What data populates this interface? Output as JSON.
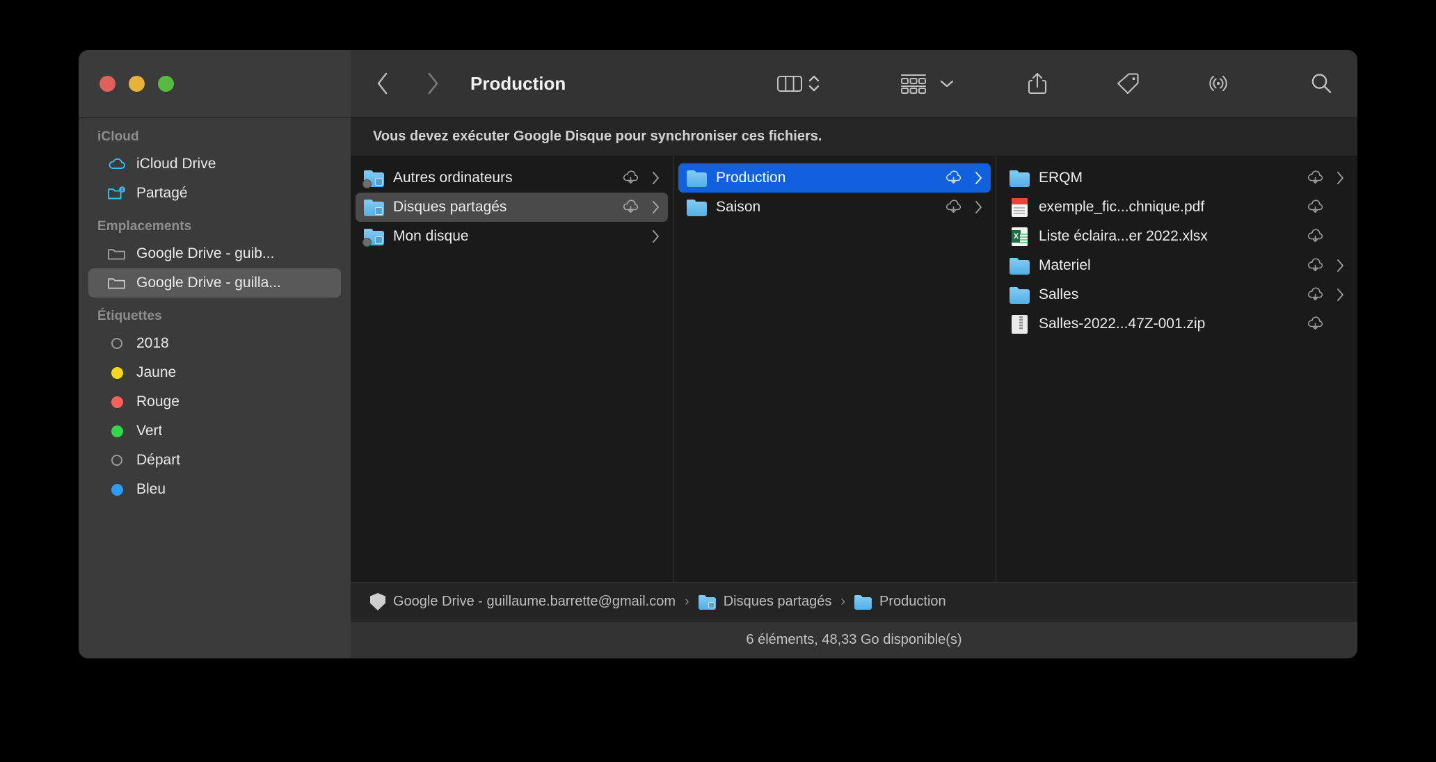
{
  "window": {
    "title": "Production",
    "traffic_lights": [
      {
        "name": "close",
        "color": "#e0615a"
      },
      {
        "name": "minimize",
        "color": "#e8b13c"
      },
      {
        "name": "zoom",
        "color": "#57bb43"
      }
    ]
  },
  "toolbar": {
    "back_label": "‹",
    "forward_label": "›",
    "title": "Production",
    "icons": [
      {
        "name": "column-view-icon",
        "label": "Présentation par colonnes"
      },
      {
        "name": "sort-stepper-icon",
        "label": "Trier"
      },
      {
        "name": "group-by-icon",
        "label": "Grouper"
      },
      {
        "name": "chevron-down-icon",
        "label": "Menu"
      },
      {
        "name": "share-icon",
        "label": "Partager"
      },
      {
        "name": "tag-icon",
        "label": "Étiquettes"
      },
      {
        "name": "airdrop-icon",
        "label": "AirDrop"
      },
      {
        "name": "search-icon",
        "label": "Rechercher"
      }
    ]
  },
  "banner": {
    "text": "Vous devez exécuter Google Disque pour synchroniser ces fichiers."
  },
  "sidebar": {
    "sections": [
      {
        "title": "iCloud",
        "items": [
          {
            "label": "iCloud Drive",
            "icon": "cloud-icon",
            "selected": false
          },
          {
            "label": "Partagé",
            "icon": "shared-folder-icon",
            "selected": false
          }
        ]
      },
      {
        "title": "Emplacements",
        "items": [
          {
            "label": "Google Drive - guib...",
            "icon": "folder-outline-icon",
            "selected": false
          },
          {
            "label": "Google Drive - guilla...",
            "icon": "folder-outline-icon",
            "selected": true
          }
        ]
      },
      {
        "title": "Étiquettes",
        "items": [
          {
            "label": "2018",
            "icon": "tag-dot-hollow",
            "color": "transparent",
            "selected": false
          },
          {
            "label": "Jaune",
            "icon": "tag-dot",
            "color": "#f5d81e",
            "selected": false
          },
          {
            "label": "Rouge",
            "icon": "tag-dot",
            "color": "#fa6258",
            "selected": false
          },
          {
            "label": "Vert",
            "icon": "tag-dot",
            "color": "#32d74b",
            "selected": false
          },
          {
            "label": "Départ",
            "icon": "tag-dot-hollow",
            "color": "transparent",
            "selected": false
          },
          {
            "label": "Bleu",
            "icon": "tag-dot",
            "color": "#2e9cf5",
            "selected": false
          }
        ]
      }
    ]
  },
  "columns": [
    {
      "name": "column-1",
      "items": [
        {
          "label": "Autres ordinateurs",
          "icon": "folder-locked-icon",
          "cloud": true,
          "chevron": true,
          "selected": "none"
        },
        {
          "label": "Disques partagés",
          "icon": "folder-shared-icon",
          "cloud": true,
          "chevron": true,
          "selected": "gray"
        },
        {
          "label": "Mon disque",
          "icon": "folder-locked-drive-icon",
          "cloud": false,
          "chevron": true,
          "selected": "none"
        }
      ]
    },
    {
      "name": "column-2",
      "items": [
        {
          "label": "Production",
          "icon": "folder-icon",
          "cloud": true,
          "chevron": true,
          "selected": "blue"
        },
        {
          "label": "Saison",
          "icon": "folder-icon",
          "cloud": true,
          "chevron": true,
          "selected": "none"
        }
      ]
    },
    {
      "name": "column-3",
      "items": [
        {
          "label": "ERQM",
          "icon": "folder-icon",
          "cloud": true,
          "chevron": true,
          "selected": "none"
        },
        {
          "label": "exemple_fic...chnique.pdf",
          "icon": "pdf-file-icon",
          "cloud": true,
          "chevron": false,
          "selected": "none"
        },
        {
          "label": "Liste éclaira...er 2022.xlsx",
          "icon": "xlsx-file-icon",
          "cloud": true,
          "chevron": false,
          "selected": "none"
        },
        {
          "label": "Materiel",
          "icon": "folder-icon",
          "cloud": true,
          "chevron": true,
          "selected": "none"
        },
        {
          "label": "Salles",
          "icon": "folder-icon",
          "cloud": true,
          "chevron": true,
          "selected": "none"
        },
        {
          "label": "Salles-2022...47Z-001.zip",
          "icon": "zip-file-icon",
          "cloud": true,
          "chevron": false,
          "selected": "none"
        }
      ]
    }
  ],
  "pathbar": {
    "crumbs": [
      {
        "label": "Google Drive - guillaume.barrette@gmail.com",
        "icon": "shield-icon"
      },
      {
        "label": "Disques partagés",
        "icon": "folder-shared-icon"
      },
      {
        "label": "Production",
        "icon": "folder-icon"
      }
    ],
    "separator": "›"
  },
  "statusbar": {
    "text": "6 éléments, 48,33 Go disponible(s)"
  },
  "colors": {
    "accent_selection": "#1160de",
    "sidebar_bg": "#3b3b3b",
    "toolbar_bg": "#333333",
    "content_bg": "#1a1a1a"
  }
}
